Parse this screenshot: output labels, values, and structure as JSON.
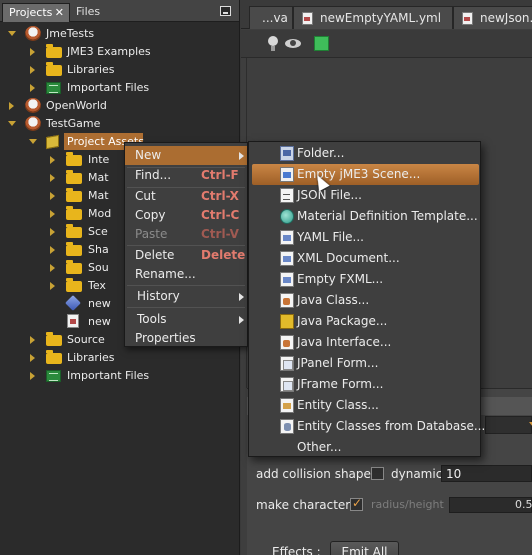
{
  "projects_panel": {
    "tabs": [
      {
        "label": "Projects",
        "active": true
      },
      {
        "label": "Files",
        "active": false
      }
    ],
    "close_glyph": "✕",
    "tree": [
      {
        "label": "JmeTests",
        "icon": "coffee-icon",
        "expander": "open"
      },
      {
        "label": "JME3 Examples",
        "icon": "folder-icon",
        "expander": "closed"
      },
      {
        "label": "Libraries",
        "icon": "folder-icon",
        "expander": "closed"
      },
      {
        "label": "Important Files",
        "icon": "important-files-icon",
        "expander": "closed"
      },
      {
        "label": "OpenWorld",
        "icon": "coffee-icon",
        "expander": "closed"
      },
      {
        "label": "TestGame",
        "icon": "coffee-icon",
        "expander": "open"
      },
      {
        "label": "Project Assets",
        "icon": "assets-box-icon",
        "expander": "open",
        "selected": true
      },
      {
        "label": "Inte",
        "icon": "folder-icon",
        "expander": "closed"
      },
      {
        "label": "Mat",
        "icon": "folder-icon",
        "expander": "closed"
      },
      {
        "label": "Mat",
        "icon": "folder-icon",
        "expander": "closed"
      },
      {
        "label": "Mod",
        "icon": "folder-icon",
        "expander": "closed"
      },
      {
        "label": "Sce",
        "icon": "folder-icon",
        "expander": "closed"
      },
      {
        "label": "Sha",
        "icon": "folder-icon",
        "expander": "closed"
      },
      {
        "label": "Sou",
        "icon": "folder-icon",
        "expander": "closed"
      },
      {
        "label": "Tex",
        "icon": "folder-icon",
        "expander": "closed"
      },
      {
        "label": "new",
        "icon": "scene-cube-icon",
        "expander": "none"
      },
      {
        "label": "new",
        "icon": "yaml-file-icon",
        "expander": "none"
      },
      {
        "label": "Source",
        "icon": "folder-icon",
        "expander": "closed"
      },
      {
        "label": "Libraries",
        "icon": "folder-icon",
        "expander": "closed"
      },
      {
        "label": "Important Files",
        "icon": "important-files-icon",
        "expander": "closed"
      }
    ]
  },
  "editor": {
    "tabs": [
      {
        "label": "...va"
      },
      {
        "label": "newEmptyYAML.yml"
      },
      {
        "label": "newJson.js"
      }
    ],
    "toolbar_icons": [
      "light-bulb-icon",
      "eye-icon",
      "green-cube-icon"
    ],
    "properties": {
      "collision_label": "add collision shape",
      "dynamic_label": "dynamic:",
      "dynamic_value": "10",
      "character_label": "make character",
      "radius_label": "radius/height",
      "radius_value": "0.5",
      "effects_label": "Effects :",
      "emit_label": "Emit All"
    }
  },
  "context_menu": {
    "items": [
      {
        "label": "New",
        "submenu": true,
        "highlighted": true
      },
      {
        "label": "Find...",
        "shortcut": "Ctrl-F"
      },
      {
        "label": "Cut",
        "shortcut": "Ctrl-X"
      },
      {
        "label": "Copy",
        "shortcut": "Ctrl-C"
      },
      {
        "label": "Paste",
        "shortcut": "Ctrl-V",
        "disabled": true
      },
      {
        "label": "Delete",
        "shortcut": "Delete"
      },
      {
        "label": "Rename..."
      },
      {
        "label": "History",
        "submenu": true
      },
      {
        "label": "Tools",
        "submenu": true
      },
      {
        "label": "Properties"
      }
    ]
  },
  "new_submenu": {
    "items": [
      {
        "label": "Folder...",
        "icon": "folder-new-icon"
      },
      {
        "label": "Empty jME3 Scene...",
        "icon": "scene-file-icon",
        "highlighted": true
      },
      {
        "label": "JSON File...",
        "icon": "json-file-icon"
      },
      {
        "label": "Material Definition Template...",
        "icon": "material-icon"
      },
      {
        "label": "YAML File...",
        "icon": "yaml-file-icon"
      },
      {
        "label": "XML Document...",
        "icon": "xml-file-icon"
      },
      {
        "label": "Empty FXML...",
        "icon": "fxml-file-icon"
      },
      {
        "label": "Java Class...",
        "icon": "java-class-icon"
      },
      {
        "label": "Java Package...",
        "icon": "java-package-icon"
      },
      {
        "label": "Java Interface...",
        "icon": "java-interface-icon"
      },
      {
        "label": "JPanel Form...",
        "icon": "jpanel-form-icon"
      },
      {
        "label": "JFrame Form...",
        "icon": "jframe-form-icon"
      },
      {
        "label": "Entity Class...",
        "icon": "entity-class-icon"
      },
      {
        "label": "Entity Classes from Database...",
        "icon": "entity-db-icon"
      },
      {
        "label": "Other...",
        "icon": ""
      }
    ]
  },
  "colors": {
    "selection": "#ad6e32",
    "menu_bg": "#3f3f3f",
    "shortcut": "#e27b6e",
    "tree_expander": "#c8a235"
  }
}
